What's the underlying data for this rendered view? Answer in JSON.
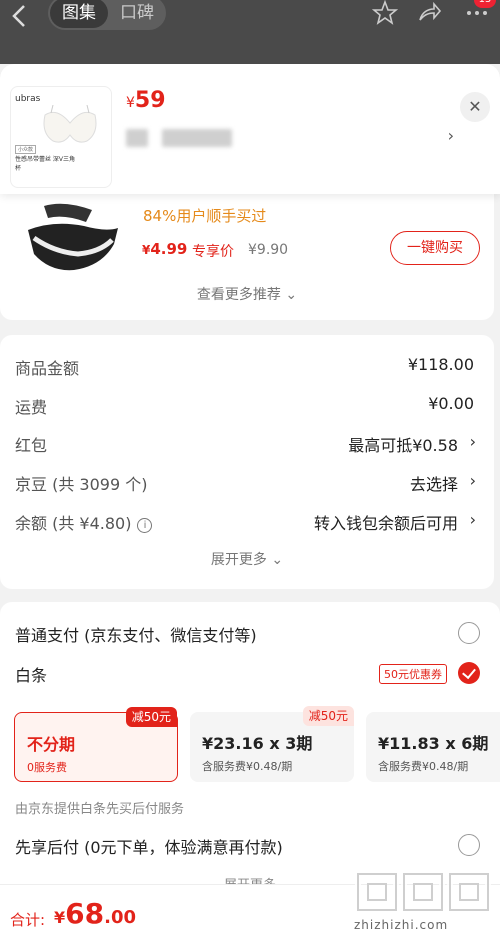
{
  "top_bar": {
    "tabs": [
      "图集",
      "口碑"
    ],
    "active_tab": "图集",
    "badge_count": "15"
  },
  "product": {
    "thumb_brand": "ubras",
    "thumb_tag": "小众款",
    "thumb_desc": "性感吊带蕾丝 深V三角杯",
    "currency": "¥",
    "price": "59"
  },
  "recommendation": {
    "purchase_rate": "84%用户顺手买过",
    "currency": "¥",
    "price": "4.99",
    "tag": "专享价",
    "old_price": "¥9.90",
    "buy_button": "一键购买",
    "see_more": "查看更多推荐 ⌄"
  },
  "fees": {
    "rows": [
      {
        "label": "商品金额",
        "value": "¥118.00"
      },
      {
        "label": "运费",
        "value": "¥0.00"
      },
      {
        "label": "红包",
        "value": "最高可抵¥0.58"
      },
      {
        "label": "京豆 (共 3099 个)",
        "value": "去选择"
      },
      {
        "label": "余额 (共 ¥4.80)",
        "value": "转入钱包余额后可用"
      }
    ],
    "expand": "展开更多 ⌄"
  },
  "payment": {
    "normal": "普通支付 (京东支付、微信支付等)",
    "baitiao": "白条",
    "coupon": "50元优惠券",
    "plans": [
      {
        "main": "不分期",
        "sub": "0服务费",
        "discount": "减50元"
      },
      {
        "main": "¥23.16 x 3期",
        "sub": "含服务费¥0.48/期",
        "discount": "减50元"
      },
      {
        "main": "¥11.83 x 6期",
        "sub": "含服务费¥0.48/期",
        "discount": ""
      }
    ],
    "provider": "由京东提供白条先买后付服务",
    "pay_after": "先享后付 (0元下单，体验满意再付款)",
    "collapse_more": "展开更多"
  },
  "bottom": {
    "total_label": "合计:",
    "currency": "¥",
    "total_int": "68",
    "total_dec": ".00"
  },
  "watermark": {
    "site": "zhizhizhi.com"
  }
}
